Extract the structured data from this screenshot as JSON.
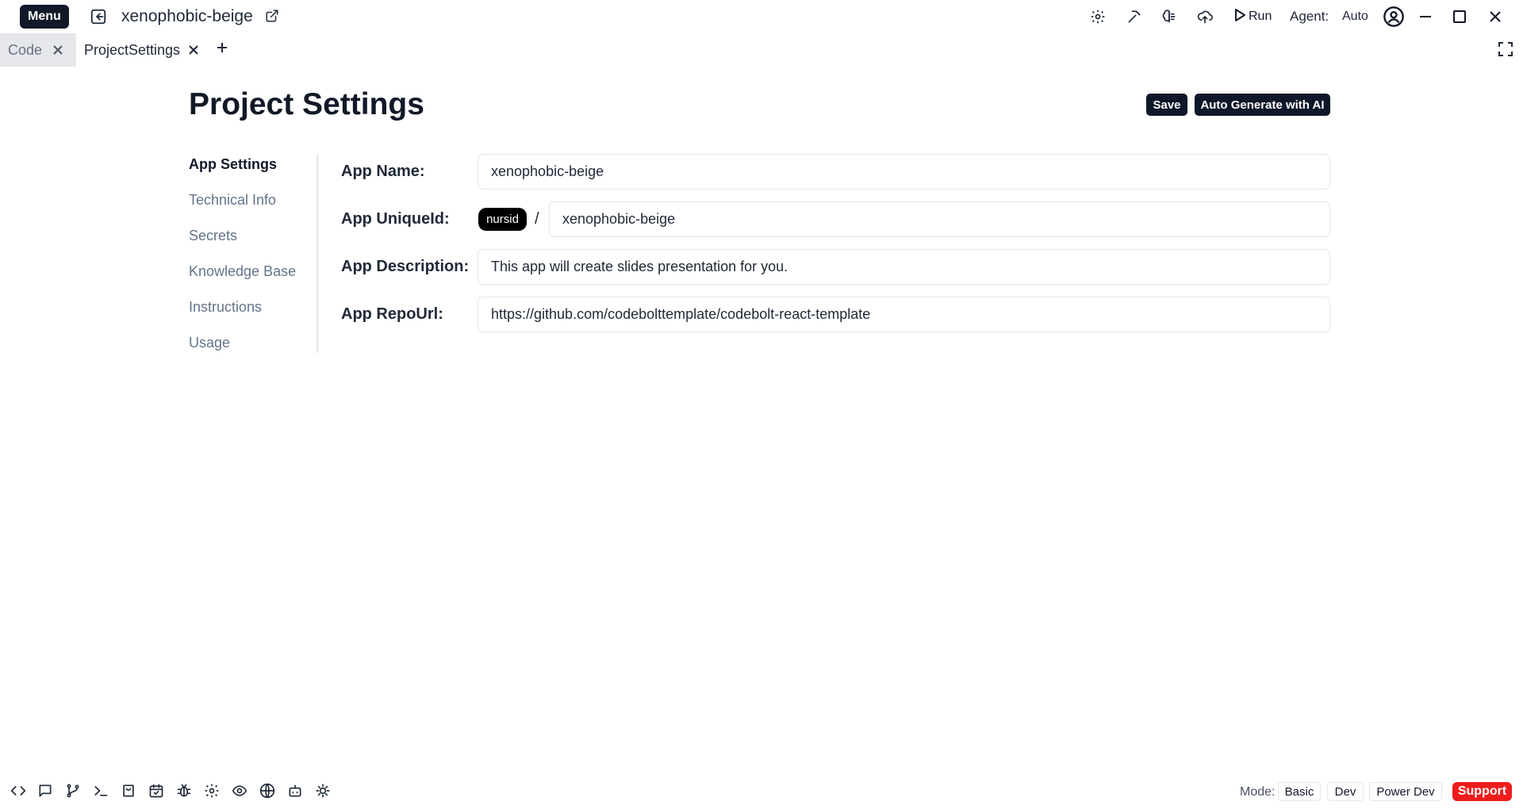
{
  "titlebar": {
    "menu_label": "Menu",
    "project_name": "xenophobic-beige",
    "run_label": "Run",
    "agent_label": "Agent:",
    "agent_value": "Auto",
    "icons": [
      "gear-icon",
      "pickaxe-icon",
      "brain-icon",
      "cloud-upload-icon",
      "play-icon",
      "user-circle-icon",
      "minimize-icon",
      "maximize-icon",
      "close-icon"
    ]
  },
  "tabs": [
    {
      "label": "Code",
      "active": false
    },
    {
      "label": "ProjectSettings",
      "active": true
    }
  ],
  "page": {
    "title": "Project Settings",
    "save_label": "Save",
    "autogen_label": "Auto Generate with AI"
  },
  "sidebar": {
    "items": [
      {
        "label": "App Settings",
        "active": true
      },
      {
        "label": "Technical Info",
        "active": false
      },
      {
        "label": "Secrets",
        "active": false
      },
      {
        "label": "Knowledge Base",
        "active": false
      },
      {
        "label": "Instructions",
        "active": false
      },
      {
        "label": "Usage",
        "active": false
      }
    ]
  },
  "form": {
    "app_name_label": "App Name:",
    "app_name_value": "xenophobic-beige",
    "app_uniqueid_label": "App UniqueId:",
    "app_uniqueid_prefix": "nursid",
    "app_uniqueid_separator": "/",
    "app_uniqueid_value": "xenophobic-beige",
    "app_description_label": "App Description:",
    "app_description_value": "This app will create slides presentation for you.",
    "app_repourl_label": "App RepoUrl:",
    "app_repourl_value": "https://github.com/codebolttemplate/codebolt-react-template"
  },
  "bottombar": {
    "icons": [
      "code-icon",
      "chat-icon",
      "git-branch-icon",
      "terminal-icon",
      "shopping-bag-icon",
      "calendar-check-icon",
      "bug-icon",
      "settings-icon",
      "eye-icon",
      "globe-icon",
      "bot-icon",
      "cog-icon"
    ],
    "mode_label": "Mode:",
    "modes": [
      "Basic",
      "Dev",
      "Power Dev"
    ],
    "support_label": "Support"
  },
  "colors": {
    "primary_dark": "#0f172a",
    "support_red": "#ef1c1c",
    "muted_text": "#64748b"
  }
}
